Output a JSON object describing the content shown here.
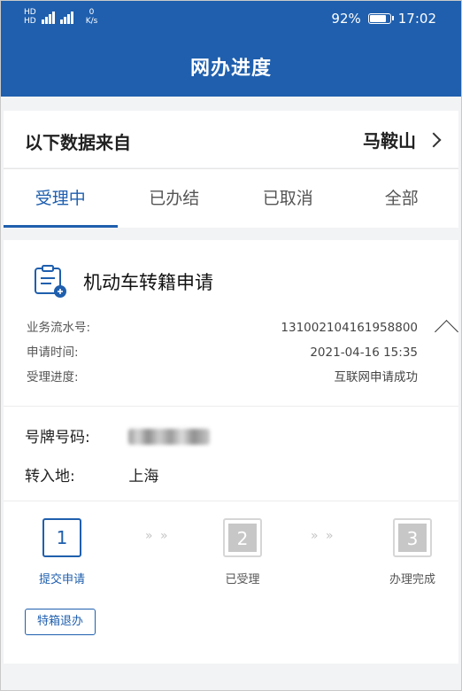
{
  "status_bar": {
    "sim1_label": "HD",
    "sim2_label": "HD",
    "net_speed_value": "0",
    "net_speed_unit": "K/s",
    "battery_percent": "92%",
    "battery_level": 0.92,
    "time": "17:02"
  },
  "header": {
    "title": "网办进度"
  },
  "source": {
    "label": "以下数据来自",
    "city": "马鞍山"
  },
  "tabs": [
    {
      "label": "受理中",
      "active": true
    },
    {
      "label": "已办结",
      "active": false
    },
    {
      "label": "已取消",
      "active": false
    },
    {
      "label": "全部",
      "active": false
    }
  ],
  "application": {
    "title": "机动车转籍申请",
    "info": [
      {
        "label": "业务流水号:",
        "value": "131002104161958800"
      },
      {
        "label": "申请时间:",
        "value": "2021-04-16 15:35"
      },
      {
        "label": "受理进度:",
        "value": "互联网申请成功"
      }
    ],
    "plate_label": "号牌号码:",
    "destination_label": "转入地:",
    "destination_value": "上海",
    "steps": [
      {
        "number": "1",
        "label": "提交申请",
        "state": "done"
      },
      {
        "number": "2",
        "label": "已受理",
        "state": "pending"
      },
      {
        "number": "3",
        "label": "办理完成",
        "state": "pending"
      }
    ],
    "step_arrow": "» »",
    "urge_button": "特箱退办"
  },
  "colors": {
    "primary": "#1f5fae",
    "background": "#f2f3f5",
    "muted": "#c7c7c7"
  },
  "icons": [
    "signal-icon",
    "battery-icon",
    "chevron-right-icon",
    "document-icon",
    "collapse-chevron-icon"
  ]
}
